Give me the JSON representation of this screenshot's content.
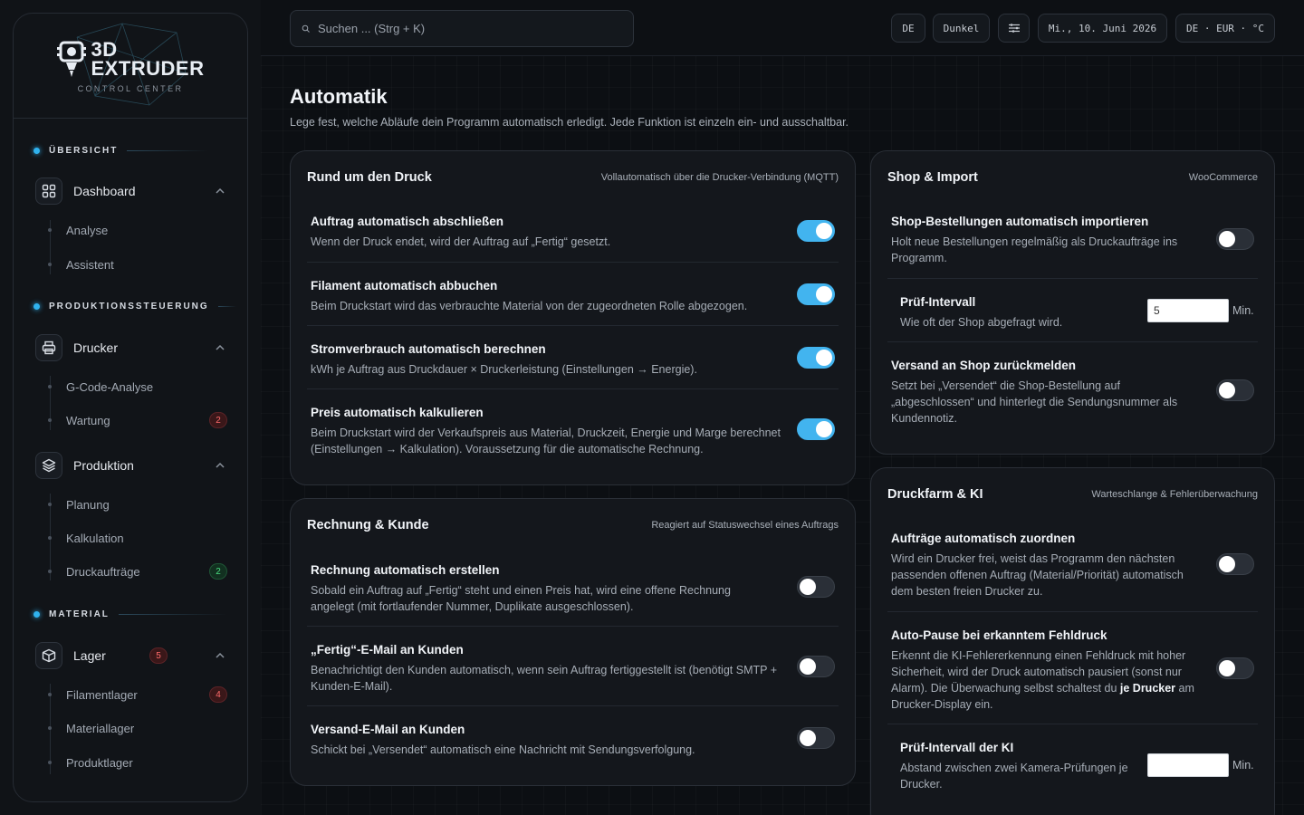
{
  "brand": {
    "title_line1": "3D",
    "title_line2": "EXTRUDER",
    "subtitle": "CONTROL CENTER"
  },
  "sidebar": {
    "sections": [
      {
        "label": "ÜBERSICHT"
      },
      {
        "label": "PRODUKTIONSSTEUERUNG"
      },
      {
        "label": "MATERIAL"
      }
    ],
    "dashboard": {
      "label": "Dashboard",
      "children": [
        "Analyse",
        "Assistent"
      ]
    },
    "drucker": {
      "label": "Drucker",
      "children": [
        "G-Code-Analyse",
        "Wartung"
      ],
      "wartung_badge": "2"
    },
    "produktion": {
      "label": "Produktion",
      "children": [
        "Planung",
        "Kalkulation",
        "Druckaufträge"
      ],
      "auftraege_badge": "2"
    },
    "lager": {
      "label": "Lager",
      "badge": "5",
      "children": [
        "Filamentlager",
        "Materiallager",
        "Produktlager"
      ],
      "filament_badge": "4"
    }
  },
  "topbar": {
    "search_placeholder": "Suchen ... (Strg + K)",
    "lang": "DE",
    "theme": "Dunkel",
    "date": "Mi., 10. Juni 2026",
    "locale": "DE · EUR · °C"
  },
  "page": {
    "title": "Automatik",
    "subtitle": "Lege fest, welche Abläufe dein Programm automatisch erledigt. Jede Funktion ist einzeln ein- und ausschaltbar."
  },
  "druck": {
    "title": "Rund um den Druck",
    "hint": "Vollautomatisch über die Drucker-Verbindung (MQTT)",
    "rows": [
      {
        "title": "Auftrag automatisch abschließen",
        "desc": "Wenn der Druck endet, wird der Auftrag auf „Fertig“ gesetzt.",
        "on": true
      },
      {
        "title": "Filament automatisch abbuchen",
        "desc": "Beim Druckstart wird das verbrauchte Material von der zugeordneten Rolle abgezogen.",
        "on": true
      },
      {
        "title": "Stromverbrauch automatisch berechnen",
        "desc": "kWh je Auftrag aus Druckdauer × Druckerleistung (Einstellungen → Energie).",
        "on": true
      },
      {
        "title": "Preis automatisch kalkulieren",
        "desc": "Beim Druckstart wird der Verkaufspreis aus Material, Druckzeit, Energie und Marge berechnet (Einstellungen → Kalkulation). Voraussetzung für die automatische Rechnung.",
        "on": true
      }
    ]
  },
  "rechnung": {
    "title": "Rechnung & Kunde",
    "hint": "Reagiert auf Statuswechsel eines Auftrags",
    "rows": [
      {
        "title": "Rechnung automatisch erstellen",
        "desc": "Sobald ein Auftrag auf „Fertig“ steht und einen Preis hat, wird eine offene Rechnung angelegt (mit fortlaufender Nummer, Duplikate ausgeschlossen).",
        "on": false
      },
      {
        "title": "„Fertig“-E-Mail an Kunden",
        "desc": "Benachrichtigt den Kunden automatisch, wenn sein Auftrag fertiggestellt ist (benötigt SMTP + Kunden-E-Mail).",
        "on": false
      },
      {
        "title": "Versand-E-Mail an Kunden",
        "desc": "Schickt bei „Versendet“ automatisch eine Nachricht mit Sendungsverfolgung.",
        "on": false
      }
    ]
  },
  "shop": {
    "title": "Shop & Import",
    "hint": "WooCommerce",
    "import": {
      "title": "Shop-Bestellungen automatisch importieren",
      "desc": "Holt neue Bestellungen regelmäßig als Druckaufträge ins Programm.",
      "on": false
    },
    "interval": {
      "title": "Prüf-Intervall",
      "desc": "Wie oft der Shop abgefragt wird.",
      "value": "5",
      "unit": "Min."
    },
    "versand": {
      "title": "Versand an Shop zurückmelden",
      "desc": "Setzt bei „Versendet“ die Shop-Bestellung auf „abgeschlossen“ und hinterlegt die Sendungsnummer als Kundennotiz.",
      "on": false
    }
  },
  "farm": {
    "title": "Druckfarm & KI",
    "hint": "Warteschlange & Fehlerüberwachung",
    "assign": {
      "title": "Aufträge automatisch zuordnen",
      "desc": "Wird ein Drucker frei, weist das Programm den nächsten passenden offenen Auftrag (Material/Priorität) automatisch dem besten freien Drucker zu.",
      "on": false
    },
    "pause": {
      "title": "Auto-Pause bei erkanntem Fehldruck",
      "desc_a": "Erkennt die KI-Fehlererkennung einen Fehldruck mit hoher Sicherheit, wird der Druck automatisch pausiert (sonst nur Alarm). Die Überwachung selbst schaltest du ",
      "desc_bold": "je Drucker",
      "desc_b": " am Drucker-Display ein.",
      "on": false
    },
    "interval": {
      "title": "Prüf-Intervall der KI",
      "desc": "Abstand zwischen zwei Kamera-Prüfungen je Drucker.",
      "value": "",
      "unit": "Min."
    }
  },
  "colors": {
    "accent": "#42b4ef",
    "badge_red": "#ff6b6b",
    "badge_green": "#4ade80"
  }
}
